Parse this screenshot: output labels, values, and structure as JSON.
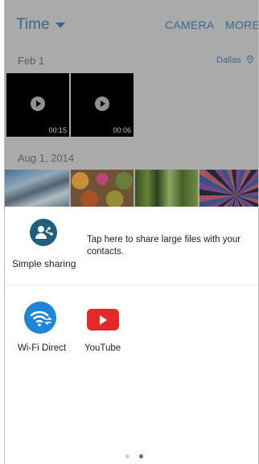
{
  "header": {
    "title": "Time",
    "actions": [
      "CAMERA",
      "MORE"
    ]
  },
  "gallery": {
    "groups": [
      {
        "date": "Feb 1",
        "location": "Dallas",
        "videos": [
          {
            "duration": "00:15"
          },
          {
            "duration": "00:06"
          }
        ]
      },
      {
        "date": "Aug 1, 2014"
      }
    ]
  },
  "share_sheet": {
    "simple_sharing": {
      "label": "Simple sharing",
      "description": "Tap here to share large files with your contacts."
    },
    "apps": [
      {
        "label": "Wi-Fi Direct",
        "icon": "wifi-direct-icon"
      },
      {
        "label": "YouTube",
        "icon": "youtube-icon"
      }
    ],
    "page_indicator": {
      "pages": 2,
      "current": 2
    }
  },
  "colors": {
    "accent": "#3f6f99",
    "simple_sharing_icon": "#1f5f7d",
    "wifi_direct_icon": "#1f86d6",
    "youtube_icon": "#e6282b"
  }
}
